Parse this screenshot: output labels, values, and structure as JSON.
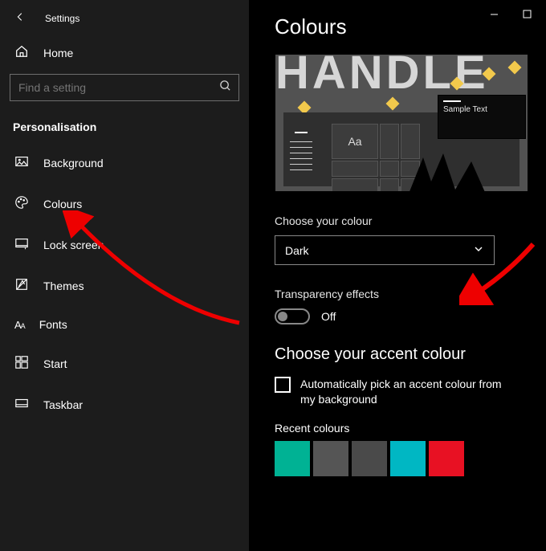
{
  "header": {
    "title": "Settings"
  },
  "home_label": "Home",
  "search": {
    "placeholder": "Find a setting"
  },
  "section_title": "Personalisation",
  "nav": {
    "background": "Background",
    "colours": "Colours",
    "lockscreen": "Lock screen",
    "themes": "Themes",
    "fonts": "Fonts",
    "start": "Start",
    "taskbar": "Taskbar"
  },
  "page": {
    "title": "Colours",
    "preview": {
      "sample_text": "Sample Text",
      "aa": "Aa",
      "bg_word": "HANDLE"
    },
    "choose_colour": {
      "label": "Choose your colour",
      "value": "Dark"
    },
    "transparency": {
      "label": "Transparency effects",
      "state": "Off"
    },
    "accent": {
      "heading": "Choose your accent colour",
      "auto_checkbox": "Automatically pick an accent colour from my background"
    },
    "recent": {
      "label": "Recent colours",
      "swatches": [
        "#00b294",
        "#555555",
        "#4a4a4a",
        "#00b7c3",
        "#e81123"
      ]
    }
  }
}
